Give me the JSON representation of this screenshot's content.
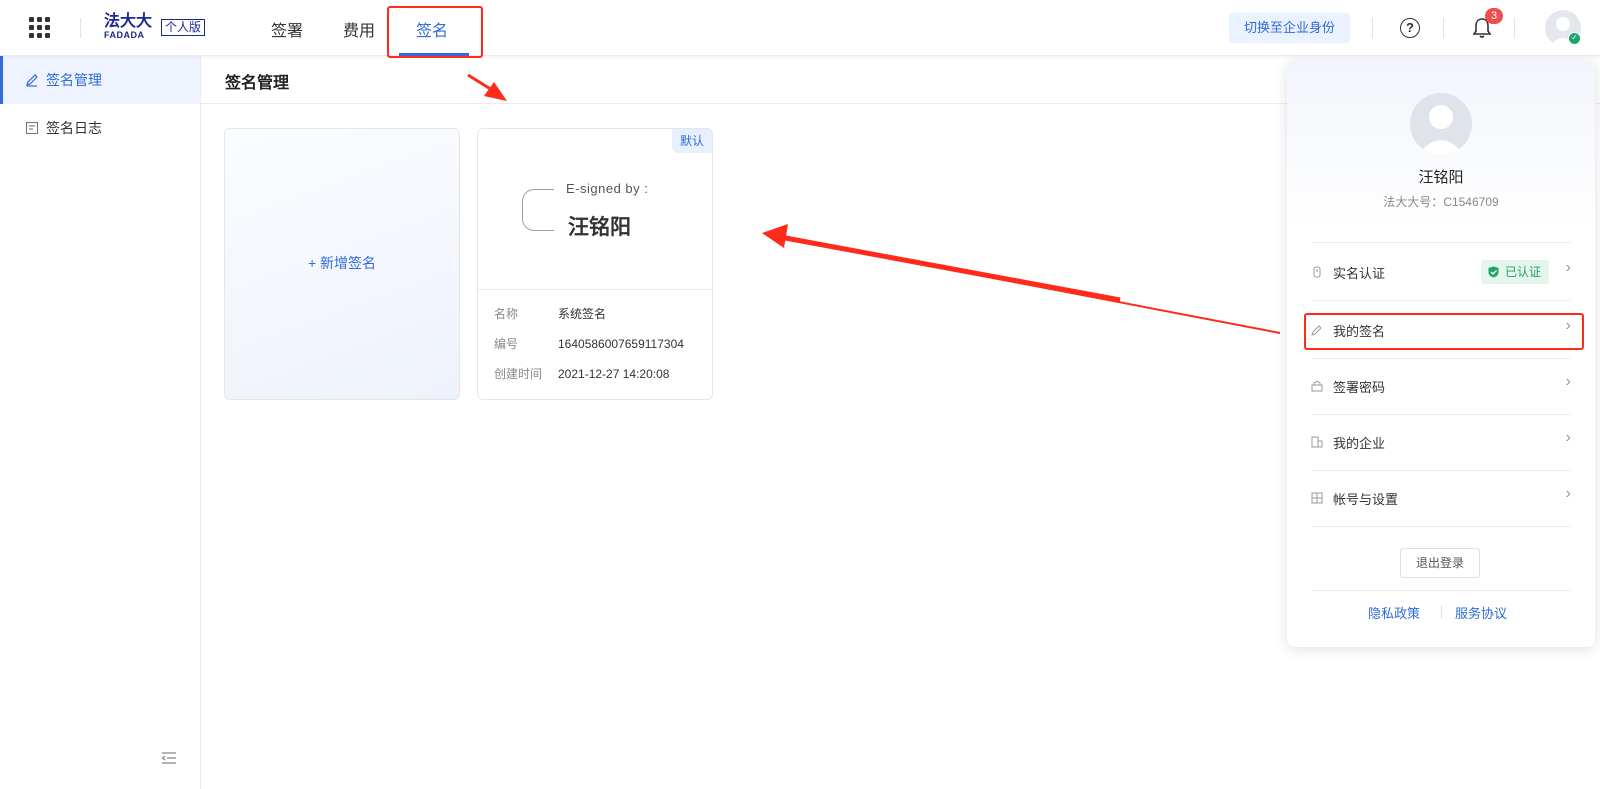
{
  "header": {
    "logo_main": "法大大",
    "logo_sub": "FADADA",
    "logo_badge": "个人版",
    "tabs": [
      {
        "label": "签署"
      },
      {
        "label": "费用"
      },
      {
        "label": "签名"
      }
    ],
    "switch_label": "切换至企业身份",
    "help_glyph": "?",
    "notification_count": "3"
  },
  "sidebar": {
    "items": [
      {
        "label": "签名管理",
        "active": true
      },
      {
        "label": "签名日志",
        "active": false
      }
    ]
  },
  "main": {
    "page_title": "签名管理",
    "add_card_label": "+ 新增签名",
    "signature": {
      "default_badge": "默认",
      "esigned_by": "E-signed by :",
      "signer_name": "汪铭阳",
      "rows": [
        {
          "key": "名称",
          "value": "系统签名"
        },
        {
          "key": "编号",
          "value": "1640586007659117304"
        },
        {
          "key": "创建时间",
          "value": "2021-12-27 14:20:08"
        }
      ]
    }
  },
  "user_panel": {
    "name": "汪铭阳",
    "account": "法大大号：C1546709",
    "menu": [
      {
        "label": "实名认证",
        "icon": "id-icon",
        "badge": "已认证"
      },
      {
        "label": "我的签名",
        "icon": "pen-icon"
      },
      {
        "label": "签署密码",
        "icon": "lock-icon"
      },
      {
        "label": "我的企业",
        "icon": "building-icon"
      },
      {
        "label": "帐号与设置",
        "icon": "settings-icon"
      }
    ],
    "chevron": "›",
    "logout": "退出登录",
    "links": [
      "隐私政策",
      "服务协议"
    ]
  },
  "colors": {
    "primary": "#2f6bdb",
    "annotation": "#ff2a1a",
    "verified": "#1fa36a",
    "badge": "#ee4e4e"
  }
}
